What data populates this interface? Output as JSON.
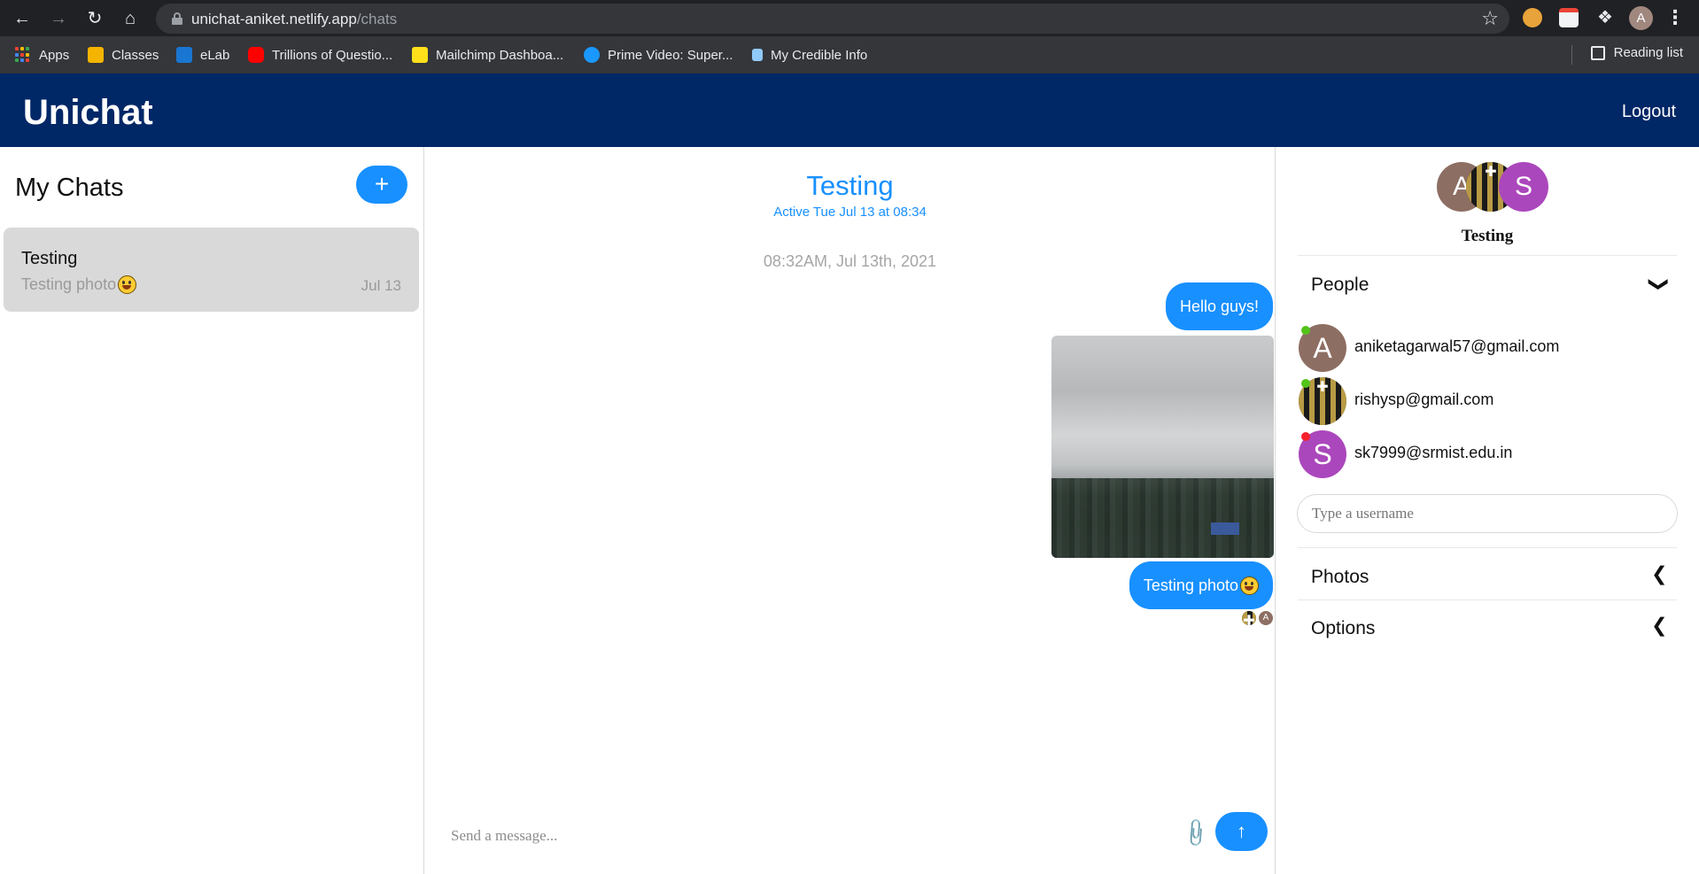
{
  "browser": {
    "url_host": "unichat-aniket.netlify.app",
    "url_path": "/chats",
    "profile_initial": "A",
    "bookmarks": [
      {
        "label": "Apps",
        "icon": "apps-grid-icon"
      },
      {
        "label": "Classes",
        "icon": "classroom-icon",
        "color": "#f4b400"
      },
      {
        "label": "eLab",
        "icon": "elab-icon",
        "color": "#1976d2"
      },
      {
        "label": "Trillions of Questio...",
        "icon": "youtube-icon",
        "color": "#ff0000"
      },
      {
        "label": "Mailchimp Dashboa...",
        "icon": "mailchimp-icon",
        "color": "#ffe01b"
      },
      {
        "label": "Prime Video: Super...",
        "icon": "prime-video-icon",
        "color": "#1a98ff"
      },
      {
        "label": "My Credible Info",
        "icon": "credible-icon",
        "color": "#90caf9"
      }
    ],
    "reading_list": "Reading list"
  },
  "app": {
    "brand": "Unichat",
    "logout": "Logout",
    "accent": "#1890ff",
    "header_bg": "#002766"
  },
  "sidebar": {
    "title": "My Chats",
    "new_chat_symbol": "+",
    "chats": [
      {
        "title": "Testing",
        "preview": "Testing photo",
        "date": "Jul 13"
      }
    ]
  },
  "chat": {
    "title": "Testing",
    "active": "Active Tue Jul 13 at 08:34",
    "timestamp": "08:32AM, Jul 13th, 2021",
    "messages": [
      {
        "type": "text",
        "text": "Hello guys!"
      },
      {
        "type": "image"
      },
      {
        "type": "text",
        "text": "Testing photo"
      }
    ],
    "composer_placeholder": "Send a message..."
  },
  "details": {
    "group_name": "Testing",
    "group_avatars": [
      {
        "initial": "A",
        "color": "#8d6e63"
      },
      {
        "initial": "",
        "color": "#1a1a1a"
      },
      {
        "initial": "S",
        "color": "#ab47bc"
      }
    ],
    "people_header": "People",
    "people": [
      {
        "initial": "A",
        "email": "aniketagarwal57@gmail.com",
        "avatar_color": "#8d6e63",
        "status_color": "#52c41a"
      },
      {
        "initial": "",
        "email": "rishysp@gmail.com",
        "avatar_color": "#1a1a1a",
        "status_color": "#52c41a"
      },
      {
        "initial": "S",
        "email": "sk7999@srmist.edu.in",
        "avatar_color": "#ab47bc",
        "status_color": "#f5222d"
      }
    ],
    "username_placeholder": "Type a username",
    "photos_header": "Photos",
    "options_header": "Options"
  }
}
